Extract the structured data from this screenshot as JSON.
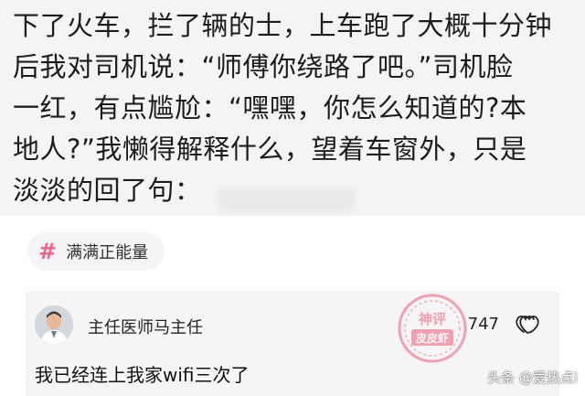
{
  "story": {
    "lines": [
      "下了火车，拦了辆的士，上车跑了大概十分钟",
      "后我对司机说：“师傅你绕路了吧。”司机脸",
      "一红，有点尴尬：“嘿嘿，你怎么知道的?本",
      "地人?”我懒得解释什么，望着车窗外，只是",
      "淡淡的回了句："
    ]
  },
  "topic": {
    "hash_symbol": "#",
    "label": "满满正能量"
  },
  "comment": {
    "username": "主任医师马主任",
    "like_count": "747",
    "text": "我已经连上我家wifi三次了"
  },
  "watermarks": {
    "stamp_text": "神评 皮皮虾",
    "stamp_color": "#f25a7c",
    "source": "头条 @爱热点i"
  },
  "icons": {
    "like": "double-heart-icon",
    "hash": "hashtag-icon"
  }
}
